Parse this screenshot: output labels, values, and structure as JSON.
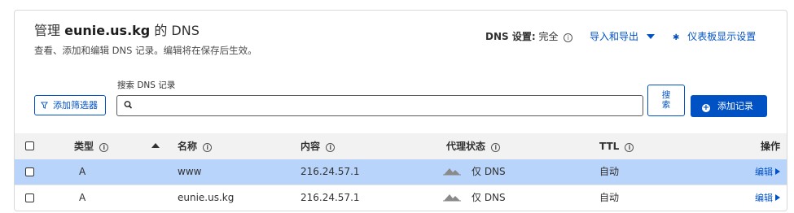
{
  "header": {
    "title_prefix": "管理",
    "domain": "eunie.us.kg",
    "title_suffix": "的 DNS",
    "subtitle": "查看、添加和编辑 DNS 记录。编辑将在保存后生效。"
  },
  "dns_setting": {
    "label": "DNS 设置:",
    "value": "完全"
  },
  "import_export_label": "导入和导出",
  "dashboard_settings_label": "仪表板显示设置",
  "toolbar": {
    "filter_label": "添加筛选器",
    "search_label": "搜索 DNS 记录",
    "search_value": "",
    "search_placeholder": "",
    "search_button_line1": "搜",
    "search_button_line2": "索",
    "add_record_label": "添加记录"
  },
  "table": {
    "columns": {
      "type": "类型",
      "name": "名称",
      "content": "内容",
      "proxy": "代理状态",
      "ttl": "TTL",
      "action": "操作"
    },
    "rows": [
      {
        "type": "A",
        "name": "www",
        "content": "216.24.57.1",
        "proxy": "仅 DNS",
        "ttl": "自动",
        "action": "编辑",
        "selected": true
      },
      {
        "type": "A",
        "name": "eunie.us.kg",
        "content": "216.24.57.1",
        "proxy": "仅 DNS",
        "ttl": "自动",
        "action": "编辑",
        "selected": false
      }
    ]
  },
  "colors": {
    "accent": "#0051c3",
    "selected_row": "#b8d4fb",
    "header_bg": "#f2f2f2",
    "cloud": "#8a8a8a"
  },
  "icons": {
    "info": "info-circle-icon",
    "dropdown": "caret-down-icon",
    "settings": "gear-icon",
    "filter": "funnel-icon",
    "search": "magnifier-icon",
    "add": "plus-circle-icon",
    "sort": "sort-ascending-icon",
    "proxy": "cloud-gray-icon",
    "edit": "caret-right-icon"
  }
}
